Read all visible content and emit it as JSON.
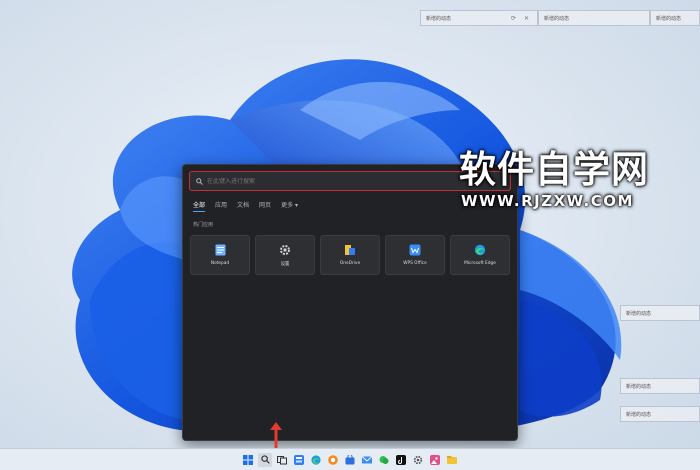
{
  "search": {
    "placeholder": "在此键入进行搜索"
  },
  "tabs": [
    {
      "label": "全部",
      "active": true
    },
    {
      "label": "应用"
    },
    {
      "label": "文档"
    },
    {
      "label": "网页"
    },
    {
      "label": "更多 ▾"
    }
  ],
  "section_title": "热门应用",
  "apps": [
    {
      "label": "Notepad",
      "icon": "notepad-icon"
    },
    {
      "label": "设置",
      "icon": "settings-gear-icon"
    },
    {
      "label": "OneDrive",
      "icon": "onedrive-icon"
    },
    {
      "label": "WPS Office",
      "icon": "wps-office-icon"
    },
    {
      "label": "Microsoft Edge",
      "icon": "edge-icon"
    }
  ],
  "widgets": {
    "label": "新增的动态"
  },
  "watermark": {
    "title": "软件自学网",
    "url": "WWW.RJZXW.COM"
  },
  "taskbar": {
    "icons": [
      "windows-start-icon",
      "search-icon",
      "task-view-icon",
      "widgets-icon",
      "edge-icon",
      "browser-icon",
      "store-icon",
      "mail-icon",
      "chat-icon",
      "tiktok-icon",
      "settings-icon",
      "photos-icon",
      "files-icon"
    ]
  },
  "colors": {
    "accent": "#1e6ff0",
    "panel": "#202225",
    "search_border": "#c52f3c",
    "watermark_fill": "#ffffff"
  }
}
